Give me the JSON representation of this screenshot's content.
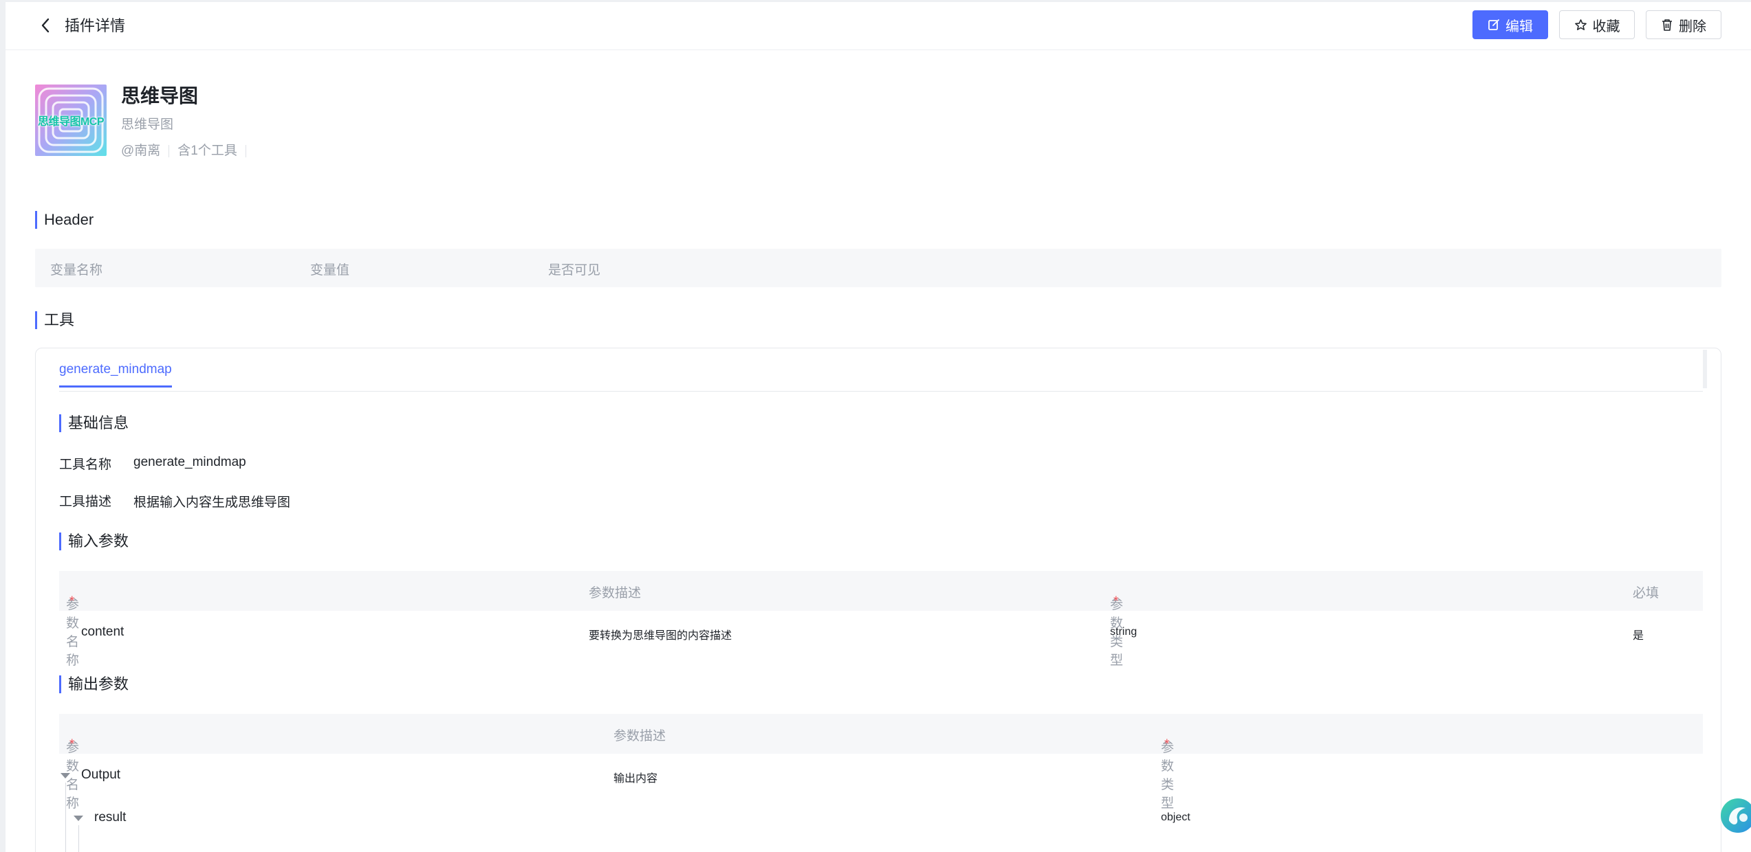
{
  "header": {
    "title": "插件详情",
    "edit_label": "编辑",
    "favorite_label": "收藏",
    "delete_label": "删除"
  },
  "plugin": {
    "logo_text": "思维导图MCP",
    "name": "思维导图",
    "subtitle": "思维导图",
    "author": "@南离",
    "tool_count": "含1个工具"
  },
  "header_section": {
    "title": "Header",
    "columns": [
      "变量名称",
      "变量值",
      "是否可见"
    ]
  },
  "tools_section": {
    "title": "工具",
    "tabs": [
      {
        "label": "generate_mindmap"
      }
    ],
    "basic_info": {
      "title": "基础信息",
      "name_label": "工具名称",
      "name_value": "generate_mindmap",
      "desc_label": "工具描述",
      "desc_value": "根据输入内容生成思维导图"
    },
    "input_params": {
      "title": "输入参数",
      "columns": [
        "参数名称",
        "参数描述",
        "参数类型",
        "必填"
      ],
      "rows": [
        {
          "name": "content",
          "description": "要转换为思维导图的内容描述",
          "type": "string",
          "required": "是"
        }
      ]
    },
    "output_params": {
      "title": "输出参数",
      "columns": [
        "参数名称",
        "参数描述",
        "参数类型"
      ],
      "rows": [
        {
          "name": "Output",
          "description": "输出内容",
          "type": ""
        },
        {
          "name": "result",
          "description": "",
          "type": "object"
        }
      ]
    },
    "required_mark": "*"
  },
  "colors": {
    "accent": "#4d6bfe",
    "required": "#f2545b",
    "muted_text": "#9aa0aa"
  },
  "icons": [
    "chevron-left-icon",
    "edit-icon",
    "star-icon",
    "trash-icon",
    "caret-down-icon",
    "assistant-logo-icon"
  ]
}
